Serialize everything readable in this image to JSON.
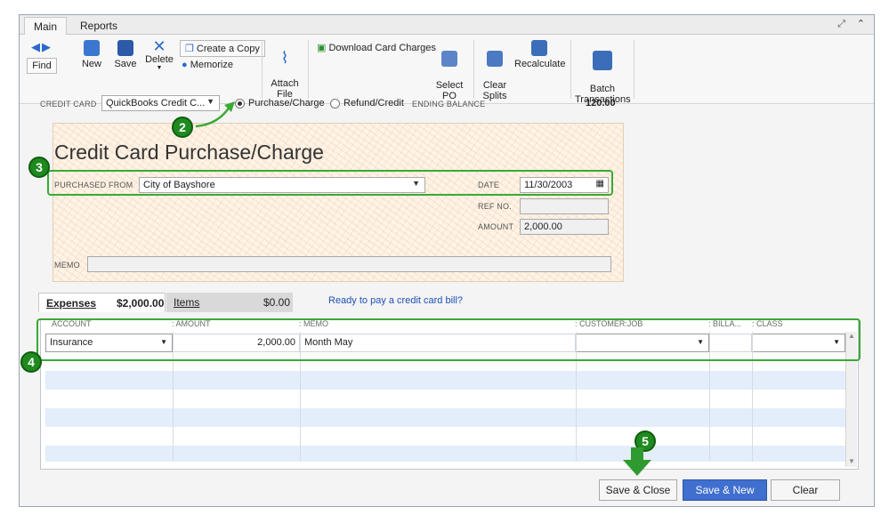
{
  "tabs": [
    "Main",
    "Reports"
  ],
  "toolbar": {
    "find": "Find",
    "new": "New",
    "save": "Save",
    "delete": "Delete",
    "create_copy": "Create a Copy",
    "memorize": "Memorize",
    "attach_file": "Attach\nFile",
    "download_card_charges": "Download Card Charges",
    "select_po": "Select\nPO",
    "clear_splits": "Clear\nSplits",
    "recalculate": "Recalculate",
    "batch_transactions": "Batch\nTransactions"
  },
  "header": {
    "credit_card_label": "CREDIT CARD",
    "credit_card_value": "QuickBooks Credit C...",
    "purchase_charge": "Purchase/Charge",
    "refund_credit": "Refund/Credit",
    "ending_balance_label": "ENDING BALANCE",
    "ending_balance_value": "120.00"
  },
  "form": {
    "title": "Credit Card Purchase/Charge",
    "purchased_from_label": "PURCHASED FROM",
    "purchased_from_value": "City of Bayshore",
    "date_label": "DATE",
    "date_value": "11/30/2003",
    "ref_label": "REF NO.",
    "ref_value": "",
    "amount_label": "AMOUNT",
    "amount_value": "2,000.00",
    "memo_label": "MEMO",
    "memo_value": ""
  },
  "detail_tabs": {
    "expenses_label": "Expenses",
    "expenses_amount": "$2,000.00",
    "items_label": "Items",
    "items_amount": "$0.00",
    "ready_link": "Ready to pay a credit card bill?"
  },
  "grid": {
    "columns": [
      "ACCOUNT",
      "AMOUNT",
      "MEMO",
      "CUSTOMER:JOB",
      "BILLA...",
      "CLASS"
    ],
    "rows": [
      {
        "account": "Insurance",
        "amount": "2,000.00",
        "memo": "Month May",
        "customer": "",
        "billable": "",
        "class": ""
      }
    ]
  },
  "badges": [
    "2",
    "3",
    "4",
    "5"
  ],
  "buttons": {
    "save_close": "Save & Close",
    "save_new": "Save & New",
    "clear": "Clear"
  },
  "colors": {
    "annotation_green": "#3aa935",
    "primary_button": "#3f6fcf",
    "grid_stripe": "#e4eefa"
  }
}
